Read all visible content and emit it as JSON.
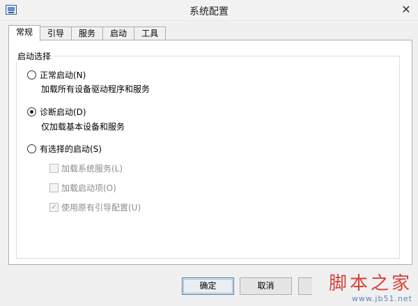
{
  "window": {
    "title": "系统配置",
    "close_glyph": "✕"
  },
  "tabs": [
    {
      "label": "常规",
      "active": true
    },
    {
      "label": "引导",
      "active": false
    },
    {
      "label": "服务",
      "active": false
    },
    {
      "label": "启动",
      "active": false
    },
    {
      "label": "工具",
      "active": false
    }
  ],
  "startup_group": {
    "label": "启动选择",
    "normal": {
      "label": "正常启动(N)",
      "desc": "加载所有设备驱动程序和服务",
      "checked": false
    },
    "diagnostic": {
      "label": "诊断启动(D)",
      "desc": "仅加载基本设备和服务",
      "checked": true
    },
    "selective": {
      "label": "有选择的启动(S)",
      "checked": false,
      "options": [
        {
          "label": "加载系统服务(L)",
          "checked": false
        },
        {
          "label": "加载启动项(O)",
          "checked": false
        },
        {
          "label": "使用原有引导配置(U)",
          "checked": true
        }
      ]
    }
  },
  "buttons": {
    "ok": "确定",
    "cancel": "取消"
  },
  "watermark": {
    "title": "脚本之家",
    "url": "www.jb51.net"
  }
}
